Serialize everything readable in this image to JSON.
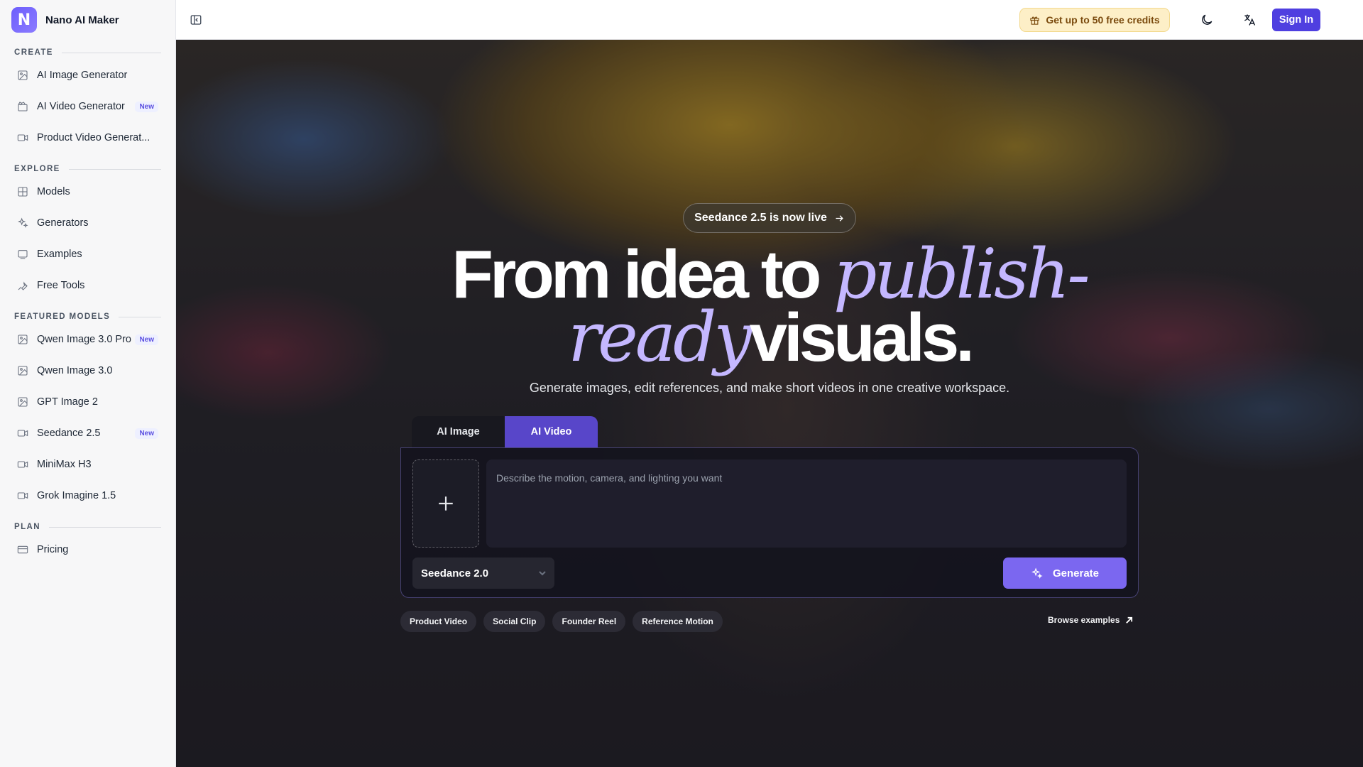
{
  "brand": {
    "logo_letter": "N",
    "name": "Nano AI Maker"
  },
  "sidebar": {
    "sections": [
      {
        "title": "CREATE",
        "items": [
          {
            "label": "AI Image Generator",
            "icon": "image-edit-icon",
            "badge": ""
          },
          {
            "label": "AI Video Generator",
            "icon": "clapperboard-icon",
            "badge": "New"
          },
          {
            "label": "Product Video Generat...",
            "icon": "video-camera-icon",
            "badge": ""
          }
        ]
      },
      {
        "title": "EXPLORE",
        "items": [
          {
            "label": "Models",
            "icon": "grid-icon",
            "badge": ""
          },
          {
            "label": "Generators",
            "icon": "sparkles-icon",
            "badge": ""
          },
          {
            "label": "Examples",
            "icon": "gallery-icon",
            "badge": ""
          },
          {
            "label": "Free Tools",
            "icon": "wrench-icon",
            "badge": ""
          }
        ]
      },
      {
        "title": "FEATURED MODELS",
        "items": [
          {
            "label": "Qwen Image 3.0 Pro",
            "icon": "image-icon",
            "badge": "New"
          },
          {
            "label": "Qwen Image 3.0",
            "icon": "image-icon",
            "badge": ""
          },
          {
            "label": "GPT Image 2",
            "icon": "image-icon",
            "badge": ""
          },
          {
            "label": "Seedance 2.5",
            "icon": "video-camera-icon",
            "badge": "New"
          },
          {
            "label": "MiniMax H3",
            "icon": "video-camera-icon",
            "badge": ""
          },
          {
            "label": "Grok Imagine 1.5",
            "icon": "video-camera-icon",
            "badge": ""
          }
        ]
      },
      {
        "title": "PLAN",
        "items": [
          {
            "label": "Pricing",
            "icon": "credit-card-icon",
            "badge": ""
          }
        ]
      }
    ]
  },
  "topbar": {
    "credits_label": "Get up to 50 free credits",
    "signin_label": "Sign In"
  },
  "hero": {
    "announcement": "Seedance 2.5 is now live",
    "headline_part1": "From idea to ",
    "headline_accent1": "publish-",
    "headline_accent2": "ready",
    "headline_part2": "visuals.",
    "subheadline": "Generate images, edit references, and make short videos in one creative workspace."
  },
  "composer": {
    "tabs": [
      {
        "label": "AI Image",
        "active": false
      },
      {
        "label": "AI Video",
        "active": true
      }
    ],
    "prompt_placeholder": "Describe the motion, camera, and lighting you want",
    "prompt_value": "",
    "model_selected": "Seedance 2.0",
    "generate_label": "Generate"
  },
  "chips": [
    "Product Video",
    "Social Clip",
    "Founder Reel",
    "Reference Motion"
  ],
  "browse_label": "Browse examples",
  "colors": {
    "accent": "#5846c9",
    "signin": "#4f3fe0",
    "generate": "#7b67f0",
    "credits_bg": "#fdefc7",
    "headline_accent": "#c4b7ff"
  }
}
